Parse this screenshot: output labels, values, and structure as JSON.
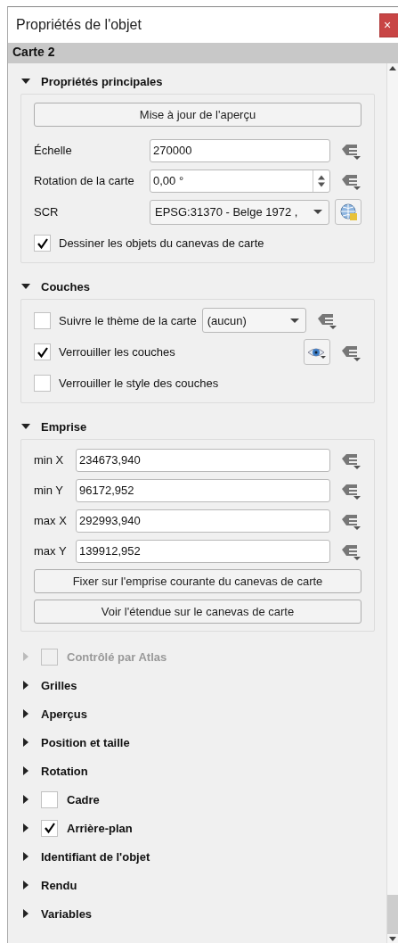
{
  "window": {
    "title": "Propriétés de l'objet",
    "close": "×"
  },
  "item_header": "Carte 2",
  "sections": [
    {
      "kind": "plain",
      "title": "Propriétés principales",
      "expanded": true,
      "rows": [
        {
          "kind": "button",
          "label": "Mise à jour de l'aperçu"
        },
        {
          "kind": "field",
          "label": "Échelle",
          "value": "270000"
        },
        {
          "kind": "spin",
          "label": "Rotation de la carte",
          "value": "0,00 °"
        },
        {
          "kind": "crs",
          "label": "SCR",
          "value": "EPSG:31370 - Belge 1972 ,"
        },
        {
          "kind": "checkbox",
          "label": "Dessiner les objets du canevas de carte",
          "checked": true
        }
      ]
    },
    {
      "kind": "plain",
      "title": "Couches",
      "expanded": true,
      "rows": [
        {
          "kind": "checkbox_combo",
          "label": "Suivre le thème de la carte",
          "checked": false,
          "value": "(aucun)"
        },
        {
          "kind": "checkbox_eye",
          "label": "Verrouiller les couches",
          "checked": true
        },
        {
          "kind": "checkbox",
          "label": "Verrouiller le style des couches",
          "checked": false
        }
      ]
    },
    {
      "kind": "plain",
      "title": "Emprise",
      "expanded": true,
      "rows": [
        {
          "kind": "short_field",
          "label": "min X",
          "value": "234673,940"
        },
        {
          "kind": "short_field",
          "label": "min Y",
          "value": "96172,952"
        },
        {
          "kind": "short_field",
          "label": "max X",
          "value": "292993,940"
        },
        {
          "kind": "short_field",
          "label": "max Y",
          "value": "139912,952"
        },
        {
          "kind": "button",
          "label": "Fixer sur l'emprise courante du canevas de carte"
        },
        {
          "kind": "button",
          "label": "Voir l'étendue sur le canevas de carte"
        }
      ]
    },
    {
      "kind": "checkable",
      "title": "Contrôlé par Atlas",
      "expanded": false,
      "disabled": true,
      "checked": false
    },
    {
      "kind": "plain",
      "title": "Grilles",
      "expanded": false,
      "disabled": false
    },
    {
      "kind": "plain",
      "title": "Aperçus",
      "expanded": false,
      "disabled": false
    },
    {
      "kind": "plain",
      "title": "Position et taille",
      "expanded": false,
      "disabled": false
    },
    {
      "kind": "plain",
      "title": "Rotation",
      "expanded": false,
      "disabled": false
    },
    {
      "kind": "checkable",
      "title": "Cadre",
      "expanded": false,
      "disabled": false,
      "checked": false
    },
    {
      "kind": "checkable",
      "title": "Arrière-plan",
      "expanded": false,
      "disabled": false,
      "checked": true
    },
    {
      "kind": "plain",
      "title": "Identifiant de l'objet",
      "expanded": false,
      "disabled": false
    },
    {
      "kind": "plain",
      "title": "Rendu",
      "expanded": false,
      "disabled": false
    },
    {
      "kind": "plain",
      "title": "Variables",
      "expanded": false,
      "disabled": false
    }
  ]
}
